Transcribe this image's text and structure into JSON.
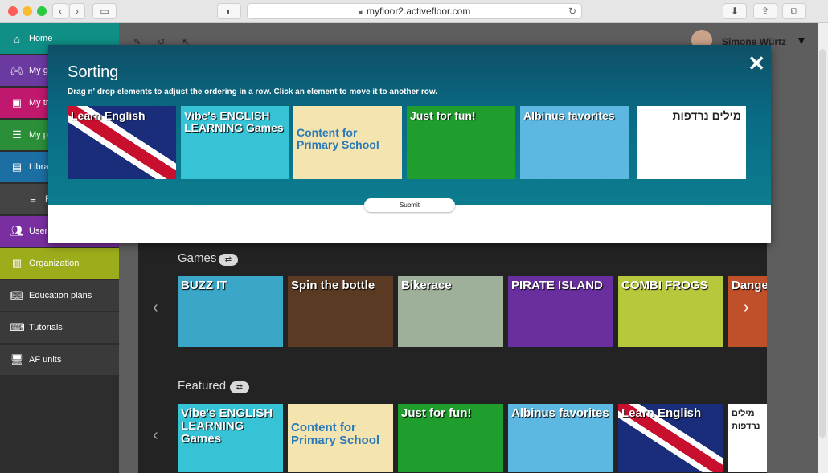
{
  "browser": {
    "url": "myfloor2.activefloor.com"
  },
  "sidebar": {
    "items": [
      {
        "label": "Home",
        "icon": "home-icon",
        "color": "#0f8f86"
      },
      {
        "label": "My g",
        "icon": "gamepad-icon",
        "color": "#6b3aa0"
      },
      {
        "label": "My tr",
        "icon": "book-icon",
        "color": "#c0186d"
      },
      {
        "label": "My p",
        "icon": "list-icon",
        "color": "#2b8f3a"
      },
      {
        "label": "Libra",
        "icon": "library-icon",
        "color": "#1c6fa3"
      },
      {
        "label": "F",
        "icon": "menu-icon",
        "color": "#3a3a3a"
      },
      {
        "label": "User",
        "icon": "users-icon",
        "color": "#7a2fa0"
      },
      {
        "label": "Organization",
        "icon": "organization-icon",
        "color": "#9cac1a"
      },
      {
        "label": "Education plans",
        "icon": "education-icon",
        "color": "#3a3a3a"
      },
      {
        "label": "Tutorials",
        "icon": "tutorials-icon",
        "color": "#3a3a3a"
      },
      {
        "label": "AF units",
        "icon": "monitor-icon",
        "color": "#3a3a3a"
      }
    ]
  },
  "header": {
    "user_name": "Simone Würtz"
  },
  "modal": {
    "title": "Sorting",
    "subtitle": "Drag n' drop elements to adjust the ordering in a row. Click an element to move it to another row.",
    "close_label": "✕",
    "submit_label": "Submit",
    "tiles": [
      {
        "label": "Learn English",
        "bg": "#1a2d7a"
      },
      {
        "label": "Vibe's ENGLISH LEARNING Games",
        "bg": "#37c3d6"
      },
      {
        "label": "Content for Primary School",
        "bg": "#f4e4b0"
      },
      {
        "label": "Just for fun!",
        "bg": "#1f9e2e"
      },
      {
        "label": "Albinus favorites",
        "bg": "#5cb8e0"
      },
      {
        "label": "מילים נרדפות",
        "bg": "#ffffff"
      }
    ]
  },
  "sections": [
    {
      "title": "Games",
      "toggle": "⇄",
      "tiles": [
        {
          "label": "BUZZ IT",
          "bg": "#3aa6c8"
        },
        {
          "label": "Spin the bottle",
          "bg": "#5a3a22"
        },
        {
          "label": "Bikerace",
          "bg": "#9fb09a"
        },
        {
          "label": "PIRATE ISLAND",
          "bg": "#6a2f9e"
        },
        {
          "label": "COMBI FROGS",
          "bg": "#b7c83c"
        },
        {
          "label": "Danger",
          "bg": "#c0502a"
        }
      ]
    },
    {
      "title": "Featured",
      "toggle": "⇄",
      "tiles": [
        {
          "label": "Vibe's ENGLISH LEARNING Games",
          "bg": "#37c3d6"
        },
        {
          "label": "Content for Primary School",
          "bg": "#f4e4b0"
        },
        {
          "label": "Just for fun!",
          "bg": "#1f9e2e"
        },
        {
          "label": "Albinus favorites",
          "bg": "#5cb8e0"
        },
        {
          "label": "Learn English",
          "bg": "#1a2d7a"
        },
        {
          "label": "מילים נרדפות",
          "bg": "#ffffff"
        }
      ]
    }
  ]
}
